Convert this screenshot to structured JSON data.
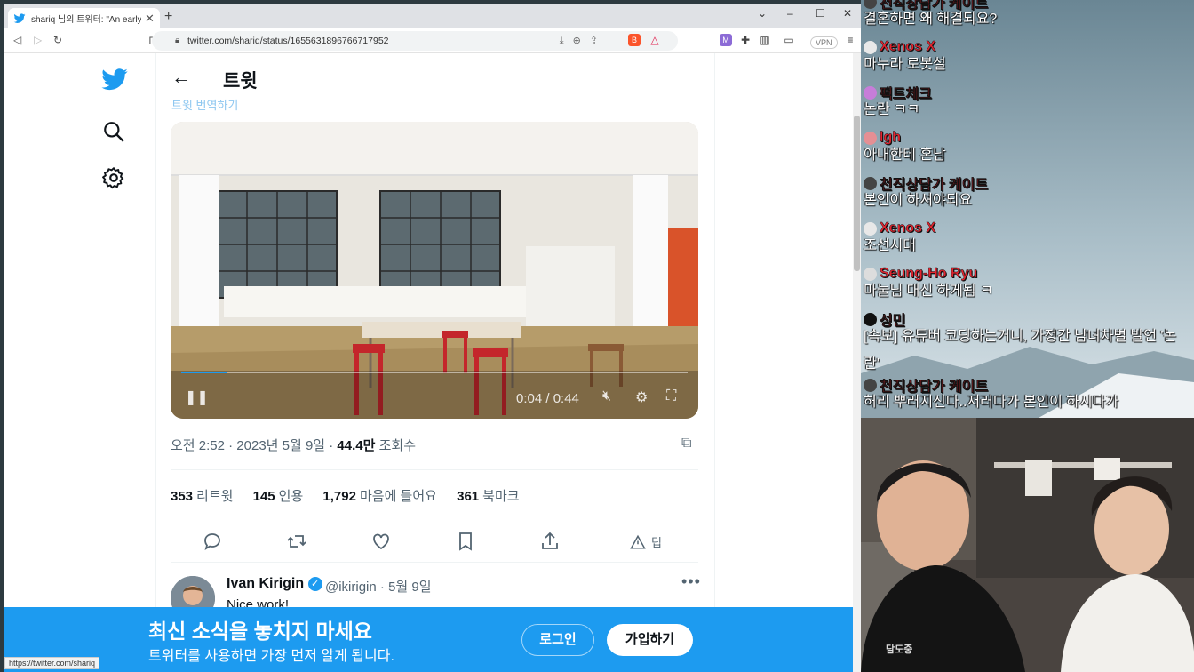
{
  "browser": {
    "tab_title": "shariq 님의 트위터: \"An early tin",
    "url": "twitter.com/shariq/status/1655631896766717952",
    "vpn_label": "VPN",
    "status_url": "https://twitter.com/shariq"
  },
  "tweet": {
    "header_title": "트윗",
    "faded_link": "트윗 번역하기",
    "video": {
      "time": "0:04 / 0:44"
    },
    "meta_prefix": "오전 2:52 · 2023년 5월 9일 · ",
    "views_count": "44.4만",
    "views_label": "조회수",
    "stats": [
      {
        "count": "353",
        "label": "리트윗"
      },
      {
        "count": "145",
        "label": "인용"
      },
      {
        "count": "1,792",
        "label": "마음에 들어요"
      },
      {
        "count": "361",
        "label": "북마크"
      }
    ],
    "tip_label": "팁"
  },
  "reply": {
    "name": "Ivan Kirigin",
    "handle_date": "@ikirigin · 5월 9일",
    "text": "Nice work!"
  },
  "banner": {
    "title": "최신 소식을 놓치지 마세요",
    "subtitle": "트위터를 사용하면 가장 먼저 알게 됩니다.",
    "login": "로그인",
    "signup": "가입하기"
  },
  "chat": [
    {
      "user": "천직상담가 케이트",
      "text": "결혼하면 왜 해결되요?"
    },
    {
      "user": "Xenos X",
      "text": "마누라 로봇설"
    },
    {
      "user": "팩트체크",
      "text": "논란 ㅋㅋ"
    },
    {
      "user": "lgh",
      "text": "아내한테 혼남"
    },
    {
      "user": "천직상담가 케이트",
      "text": "본인이 하셔야되요"
    },
    {
      "user": "Xenos X",
      "text": "조선시대"
    },
    {
      "user": "Seung-Ho Ryu",
      "text": "마눌님 대신 하게됨 ㅋ"
    },
    {
      "user": "성민",
      "text": "[속보] 유튜버 코딩하는거니, 가정간 남녀차별 발언 '논"
    },
    {
      "user": "",
      "text": "란'"
    },
    {
      "user": "천직상담가 케이트",
      "text": "허리 뿌러지신다..저러다가 본인이 하시다가"
    }
  ],
  "cam": {
    "shirt_text": "담도중"
  },
  "colors": {
    "twitter_blue": "#1d9bf0",
    "chat_name": "#e4242f"
  }
}
